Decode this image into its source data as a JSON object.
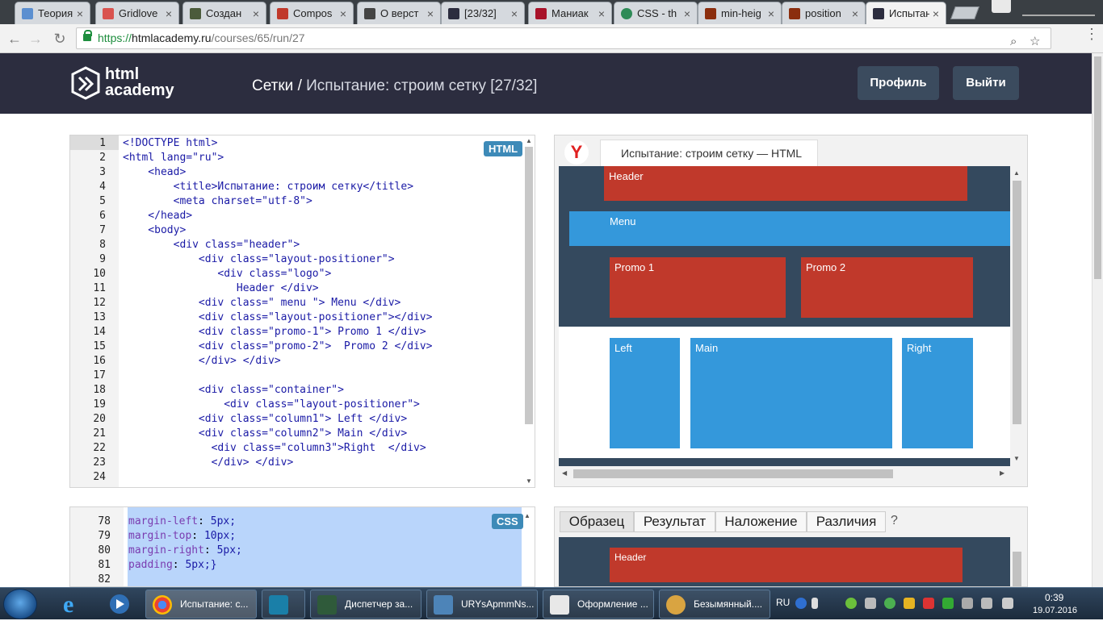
{
  "browser": {
    "tabs": [
      {
        "title": "Теория",
        "color": "#5b8fd0"
      },
      {
        "title": "Gridlove",
        "color": "#d9534f"
      },
      {
        "title": "Создан",
        "color": "#4b5b3b"
      },
      {
        "title": "Compos",
        "color": "#c0392b"
      },
      {
        "title": "О верст",
        "color": "#444"
      },
      {
        "title": "[23/32]",
        "color": "#2c2d3f"
      },
      {
        "title": "Маниак",
        "color": "#a8122a"
      },
      {
        "title": "CSS - th",
        "color": "#2e8b57"
      },
      {
        "title": "min-heig",
        "color": "#8b2e0e"
      },
      {
        "title": "position",
        "color": "#8b2e0e"
      },
      {
        "title": "Испытан",
        "color": "#2c2d3f"
      }
    ],
    "url_prefix": "https://",
    "url_host": "htmlacademy.ru",
    "url_path": "/courses/65/run/27"
  },
  "site": {
    "logo_line1": "html",
    "logo_line2": "academy",
    "crumb_section": "Сетки /",
    "crumb_title": "Испытание: строим сетку",
    "crumb_progress": "[27/32]",
    "profile_button": "Профиль",
    "logout_button": "Выйти"
  },
  "html_editor": {
    "badge": "HTML",
    "lines": [
      {
        "n": "1",
        "code": "<!DOCTYPE html>"
      },
      {
        "n": "2",
        "code": "<html lang=\"ru\">"
      },
      {
        "n": "3",
        "code": "    <head>"
      },
      {
        "n": "4",
        "code": "        <title>Испытание: строим сетку</title>"
      },
      {
        "n": "5",
        "code": "        <meta charset=\"utf-8\">"
      },
      {
        "n": "6",
        "code": "    </head>"
      },
      {
        "n": "7",
        "code": "    <body>"
      },
      {
        "n": "8",
        "code": "        <div class=\"header\">"
      },
      {
        "n": "9",
        "code": "            <div class=\"layout-positioner\">"
      },
      {
        "n": "10",
        "code": "               <div class=\"logo\">"
      },
      {
        "n": "11",
        "code": "                  Header </div>"
      },
      {
        "n": "12",
        "code": "            <div class=\" menu \"> Menu </div>"
      },
      {
        "n": "13",
        "code": "            <div class=\"layout-positioner\"></div>"
      },
      {
        "n": "14",
        "code": "            <div class=\"promo-1\"> Promo 1 </div>"
      },
      {
        "n": "15",
        "code": "            <div class=\"promo-2\">  Promo 2 </div>"
      },
      {
        "n": "16",
        "code": "            </div> </div>"
      },
      {
        "n": "17",
        "code": ""
      },
      {
        "n": "18",
        "code": "            <div class=\"container\">"
      },
      {
        "n": "19",
        "code": "                <div class=\"layout-positioner\">"
      },
      {
        "n": "20",
        "code": "            <div class=\"column1\"> Left </div>"
      },
      {
        "n": "21",
        "code": "            <div class=\"column2\"> Main </div>"
      },
      {
        "n": "22",
        "code": "              <div class=\"column3\">Right  </div>"
      },
      {
        "n": "23",
        "code": "              </div> </div>"
      },
      {
        "n": "24",
        "code": ""
      }
    ]
  },
  "css_editor": {
    "badge": "CSS",
    "lines": [
      {
        "n": "78",
        "prop": "margin-left",
        "val": "5px;"
      },
      {
        "n": "79",
        "prop": "margin-top",
        "val": "10px;"
      },
      {
        "n": "80",
        "prop": "margin-right",
        "val": "5px;"
      },
      {
        "n": "81",
        "prop": "padding",
        "val": "5px;}"
      },
      {
        "n": "82",
        "prop": "",
        "val": ""
      }
    ]
  },
  "preview": {
    "tab_title": "Испытание: строим сетку — HTML",
    "blocks": {
      "header": "Header",
      "menu": "Menu",
      "promo1": "Promo 1",
      "promo2": "Promo 2",
      "left": "Left",
      "main": "Main",
      "right": "Right"
    },
    "colors": {
      "red": "#c0392b",
      "blue": "#3498db",
      "dark": "#34495e"
    }
  },
  "compare": {
    "tabs": [
      "Образец",
      "Результат",
      "Наложение",
      "Различия"
    ],
    "help": "?",
    "header_block": "Header"
  },
  "taskbar": {
    "items": [
      {
        "label": "Испытание: с..."
      },
      {
        "label": ""
      },
      {
        "label": "Диспетчер за..."
      },
      {
        "label": "URYsApmmNs..."
      },
      {
        "label": "Оформление ..."
      },
      {
        "label": "Безымянный...."
      }
    ],
    "lang": "RU",
    "time": "0:39",
    "date": "19.07.2016"
  }
}
